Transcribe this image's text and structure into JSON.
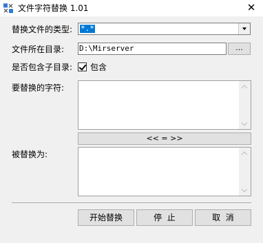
{
  "window": {
    "title": "文件字符替换 1.01",
    "close_glyph": "✕"
  },
  "form": {
    "file_type_label": "替换文件的类型:",
    "file_type_value": "*.*",
    "directory_label": "文件所在目录:",
    "directory_value": "D:\\Mirserver",
    "browse_label": "...",
    "subdir_label": "是否包含子目录:",
    "subdir_checked": true,
    "subdir_checkbox_label": "包含",
    "search_label": "要替换的字符:",
    "search_text": "",
    "swap_label": "<< = >>",
    "replace_label": "被替换为:",
    "replace_text": ""
  },
  "buttons": {
    "start": "开始替换",
    "stop": "停  止",
    "cancel": "取  消"
  }
}
